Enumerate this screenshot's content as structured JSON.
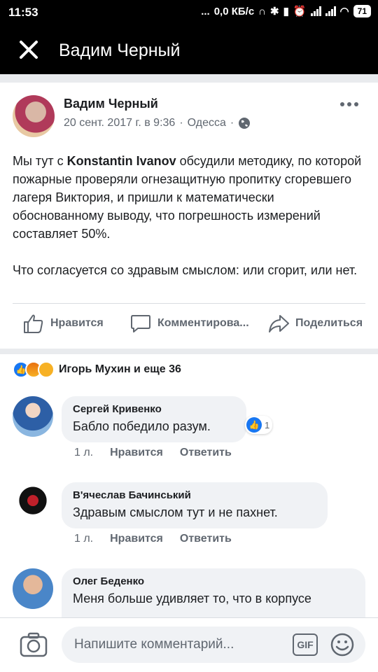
{
  "status": {
    "time": "11:53",
    "dots": "...",
    "net_speed": "0,0 КБ/с",
    "battery": "71"
  },
  "header": {
    "title": "Вадим Черный"
  },
  "post": {
    "author": "Вадим Черный",
    "date": "20 сент. 2017 г. в 9:36",
    "sep": "·",
    "location": "Одесса",
    "text_part1": "Мы тут с ",
    "text_mention": "Konstantin Ivanov",
    "text_part2": " обсудили методику, по которой пожарные проверяли огнезащитную пропитку сгоревшего лагеря Виктория, и пришли к математически обоснованному выводу, что погрешность измерений составляет 50%.",
    "text_para2": "Что согласуется со здравым смыслом: или сгорит, или нет.",
    "actions": {
      "like": "Нравится",
      "comment": "Комментирова...",
      "share": "Поделиться"
    }
  },
  "reactions": {
    "summary": "Игорь Мухин и еще 36"
  },
  "comments": [
    {
      "name": "Сергей Кривенко",
      "text": "Бабло победило разум.",
      "time": "1 л.",
      "like": "Нравится",
      "reply": "Ответить",
      "like_count": "1"
    },
    {
      "name": "В'ячеслав Бачинський",
      "text": "Здравым смыслом тут и не пахнет.",
      "time": "1 л.",
      "like": "Нравится",
      "reply": "Ответить"
    },
    {
      "name": "Олег Беденко",
      "text": "Меня больше удивляет то, что в корпусе"
    }
  ],
  "composer": {
    "placeholder": "Напишите комментарий...",
    "gif": "GIF"
  },
  "colors": {
    "accent": "#1877f2",
    "header_bg": "#000000",
    "meta_gray": "#606770"
  }
}
